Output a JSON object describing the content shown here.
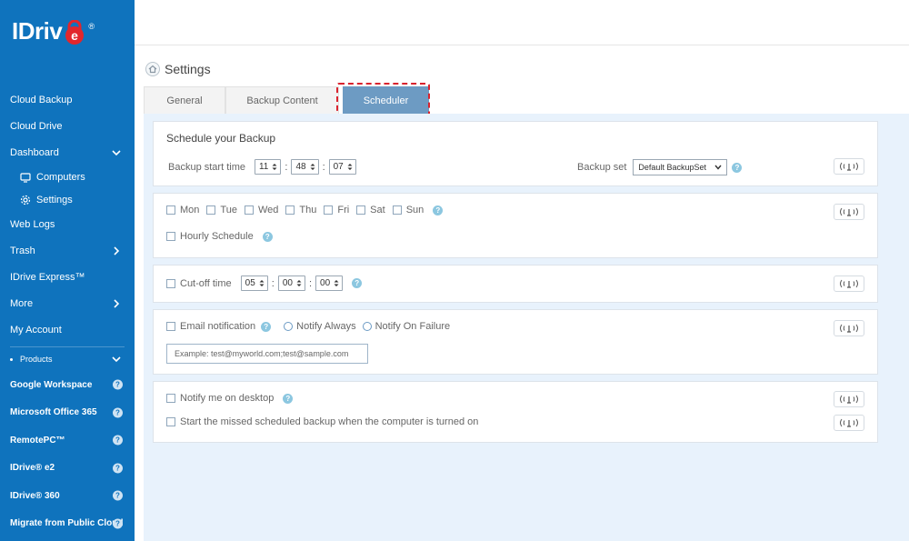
{
  "logo": {
    "text": "IDriv",
    "letter_e": "e",
    "reg": "®"
  },
  "sidebar": {
    "items": [
      {
        "label": "Cloud Backup"
      },
      {
        "label": "Cloud Drive"
      },
      {
        "label": "Dashboard"
      },
      {
        "label": "Computers"
      },
      {
        "label": "Settings"
      },
      {
        "label": "Web Logs"
      },
      {
        "label": "Trash"
      },
      {
        "label": "IDrive Express™"
      },
      {
        "label": "More"
      },
      {
        "label": "My Account"
      }
    ],
    "products_label": "Products",
    "products": [
      {
        "label": "Google Workspace",
        "help": "?"
      },
      {
        "label": "Microsoft Office 365",
        "help": "?"
      },
      {
        "label": "RemotePC™",
        "help": "?"
      },
      {
        "label": "IDrive® e2",
        "help": "?"
      },
      {
        "label": "IDrive® 360",
        "help": "?"
      },
      {
        "label": "Migrate from Public Cloud",
        "help": "?"
      }
    ]
  },
  "page": {
    "title": "Settings"
  },
  "tabs": [
    {
      "label": "General"
    },
    {
      "label": "Backup Content"
    },
    {
      "label": "Scheduler",
      "active": true
    }
  ],
  "schedule": {
    "title": "Schedule your Backup",
    "start_time_label": "Backup start time",
    "hour": "11",
    "minute": "48",
    "second": "07",
    "backup_set_label": "Backup set",
    "backup_set_value": "Default BackupSet",
    "help": "?"
  },
  "days": {
    "items": [
      "Mon",
      "Tue",
      "Wed",
      "Thu",
      "Fri",
      "Sat",
      "Sun"
    ],
    "hourly_label": "Hourly Schedule",
    "help": "?"
  },
  "cutoff": {
    "label": "Cut-off time",
    "hour": "05",
    "minute": "00",
    "second": "00",
    "help": "?"
  },
  "email": {
    "label": "Email notification",
    "help": "?",
    "notify_always": "Notify Always",
    "notify_failure": "Notify On Failure",
    "placeholder": "Example: test@myworld.com;test@sample.com"
  },
  "desktop": {
    "notify_label": "Notify me on desktop",
    "help": "?",
    "missed_label": "Start the missed scheduled backup when the computer is turned on"
  },
  "colors": {
    "sidebar_bg": "#0f73bd",
    "active_tab": "#6d9bc3",
    "content_bg": "#e8f2fc",
    "highlight": "#d9232e",
    "logo_red": "#e2262c"
  }
}
